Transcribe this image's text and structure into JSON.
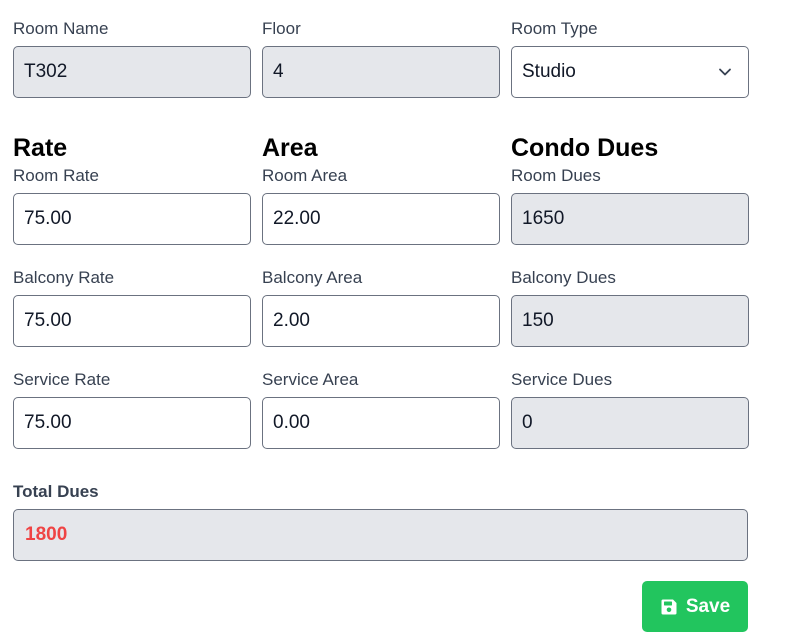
{
  "room": {
    "name_label": "Room Name",
    "name_value": "T302",
    "floor_label": "Floor",
    "floor_value": "4",
    "type_label": "Room Type",
    "type_value": "Studio"
  },
  "sections": {
    "rate_heading": "Rate",
    "area_heading": "Area",
    "dues_heading": "Condo Dues"
  },
  "room_row": {
    "rate_label": "Room Rate",
    "rate_value": "75.00",
    "area_label": "Room Area",
    "area_value": "22.00",
    "dues_label": "Room Dues",
    "dues_value": "1650"
  },
  "balcony_row": {
    "rate_label": "Balcony Rate",
    "rate_value": "75.00",
    "area_label": "Balcony Area",
    "area_value": "2.00",
    "dues_label": "Balcony Dues",
    "dues_value": "150"
  },
  "service_row": {
    "rate_label": "Service Rate",
    "rate_value": "75.00",
    "area_label": "Service Area",
    "area_value": "0.00",
    "dues_label": "Service Dues",
    "dues_value": "0"
  },
  "total": {
    "label": "Total Dues",
    "value": "1800"
  },
  "actions": {
    "save_label": "Save",
    "save_icon": "floppy-disk-icon"
  },
  "colors": {
    "save_button": "#22c55e",
    "total_value": "#ef4444",
    "readonly_bg": "#e5e7eb"
  }
}
